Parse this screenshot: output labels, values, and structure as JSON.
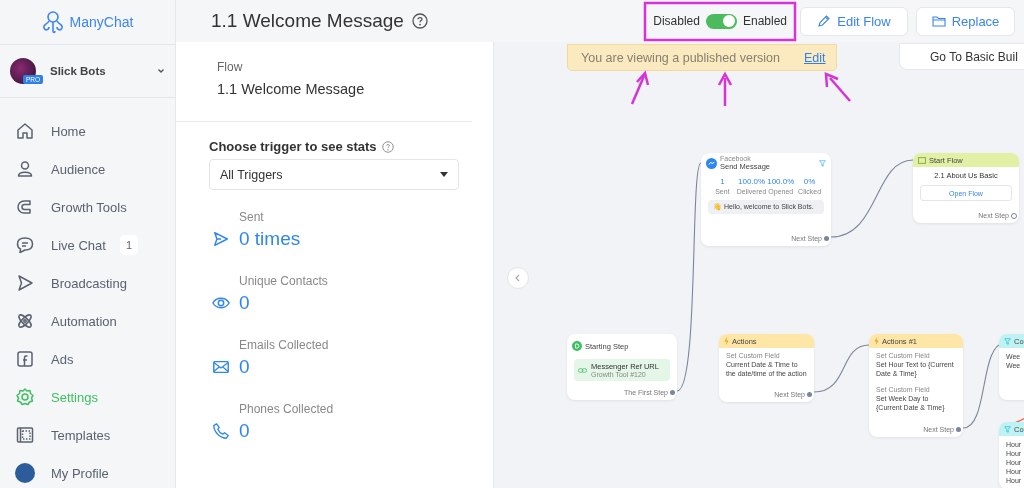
{
  "sidebar": {
    "brand": "ManyChat",
    "account": {
      "name": "Slick Bots",
      "badge": "PRO"
    },
    "items": [
      {
        "label": "Home",
        "selected": false
      },
      {
        "label": "Audience",
        "selected": false
      },
      {
        "label": "Growth Tools",
        "selected": false
      },
      {
        "label": "Live Chat",
        "selected": false,
        "count": "1"
      },
      {
        "label": "Broadcasting",
        "selected": false
      },
      {
        "label": "Automation",
        "selected": false
      },
      {
        "label": "Ads",
        "selected": false
      },
      {
        "label": "Settings",
        "selected": true
      },
      {
        "label": "Templates",
        "selected": false
      },
      {
        "label": "My Profile",
        "selected": false
      }
    ]
  },
  "header": {
    "title": "1.1 Welcome Message",
    "toggle": {
      "off_label": "Disabled",
      "on_label": "Enabled",
      "on": true
    },
    "buttons": [
      {
        "label": "Edit Flow"
      },
      {
        "label": "Replace"
      }
    ]
  },
  "stats_panel": {
    "flow_label": "Flow",
    "flow_name": "1.1 Welcome Message",
    "trigger_label": "Choose trigger to see stats",
    "trigger_select": "All Triggers",
    "stats": [
      {
        "label": "Sent",
        "value": "0 times"
      },
      {
        "label": "Unique Contacts",
        "value": "0"
      },
      {
        "label": "Emails Collected",
        "value": "0"
      },
      {
        "label": "Phones Collected",
        "value": "0"
      }
    ]
  },
  "canvas": {
    "banner": {
      "text": "You are viewing a published version",
      "link": "Edit"
    },
    "basic_builder_button": "Go To Basic Buil",
    "nodes": [
      {
        "kind": "message",
        "channel": "Facebook",
        "title": "Send Message",
        "metrics": [
          {
            "value": "1",
            "label": "Sent"
          },
          {
            "value": "100.0%",
            "label": "Delivered"
          },
          {
            "value": "100.0%",
            "label": "Opened"
          },
          {
            "value": "0%",
            "label": "Clicked"
          }
        ],
        "message": "👋 Hello, welcome to Slick Bots.",
        "next": "Next Step"
      },
      {
        "kind": "start_flow",
        "title": "Start Flow",
        "flow": "2.1 About Us Basic",
        "button": "Open Flow",
        "next": "Next Step"
      },
      {
        "kind": "start",
        "title": "Starting Step",
        "trigger_title": "Messenger Ref URL",
        "trigger_subtitle": "Growth Tool #120",
        "next": "The First Step"
      },
      {
        "kind": "actions",
        "title": "Actions",
        "items": [
          {
            "label": "Set Custom Field",
            "text": "Current Date & Time to the date/time of the action"
          }
        ],
        "next": "Next Step"
      },
      {
        "kind": "actions",
        "title": "Actions #1",
        "items": [
          {
            "label": "Set Custom Field",
            "text": "Set Hour Text to {Current Date & Time}"
          },
          {
            "label": "Set Custom Field",
            "text": "Set Week Day to {Current Date & Time}"
          }
        ],
        "next": "Next Step"
      },
      {
        "kind": "condition",
        "title": "Co",
        "lines": [
          "Wee",
          "Wee"
        ]
      },
      {
        "kind": "condition",
        "title": "Co",
        "lines": [
          "Hour",
          "Hour",
          "Hour",
          "Hour",
          "Hour"
        ]
      }
    ]
  }
}
